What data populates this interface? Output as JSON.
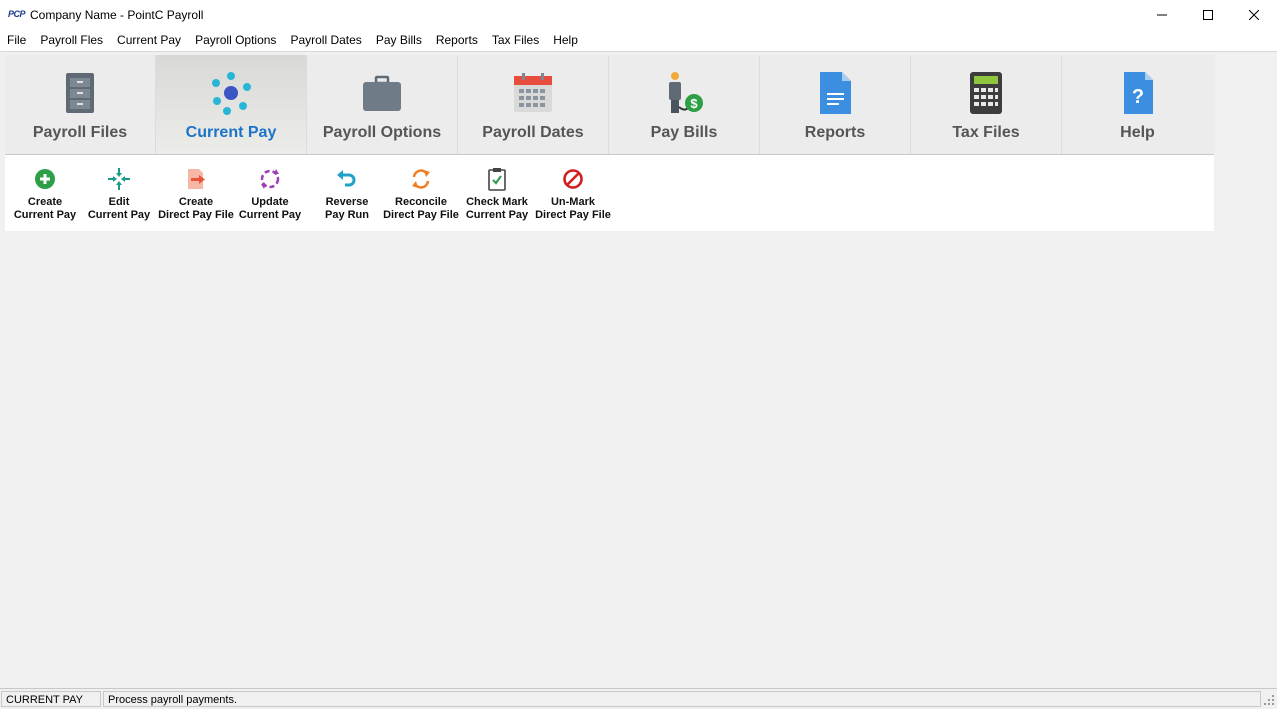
{
  "window": {
    "app_icon_text": "PCP",
    "title": "Company Name - PointC Payroll"
  },
  "menu": [
    "File",
    "Payroll Fles",
    "Current Pay",
    "Payroll Options",
    "Payroll Dates",
    "Pay Bills",
    "Reports",
    "Tax Files",
    "Help"
  ],
  "ribbon": {
    "active_tab": "Current Pay",
    "tabs": [
      {
        "label": "Payroll Files",
        "icon": "filing-cabinet-icon"
      },
      {
        "label": "Current Pay",
        "icon": "network-nodes-icon"
      },
      {
        "label": "Payroll Options",
        "icon": "briefcase-icon"
      },
      {
        "label": "Payroll Dates",
        "icon": "calendar-icon"
      },
      {
        "label": "Pay Bills",
        "icon": "person-dollar-icon"
      },
      {
        "label": "Reports",
        "icon": "document-icon"
      },
      {
        "label": "Tax Files",
        "icon": "calculator-icon"
      },
      {
        "label": "Help",
        "icon": "help-document-icon"
      }
    ]
  },
  "toolbar": {
    "buttons": [
      {
        "line1": "Create",
        "line2": "Current Pay",
        "icon": "plus-circle-icon",
        "color": "#2e9e47"
      },
      {
        "line1": "Edit",
        "line2": "Current Pay",
        "icon": "compress-arrows-icon",
        "color": "#1a9a8a"
      },
      {
        "line1": "Create",
        "line2": "Direct Pay File",
        "icon": "file-export-icon",
        "color": "#e8553a"
      },
      {
        "line1": "Update",
        "line2": "Current Pay",
        "icon": "refresh-dashed-icon",
        "color": "#9b3fb5"
      },
      {
        "line1": "Reverse",
        "line2": "Pay Run",
        "icon": "undo-arrow-icon",
        "color": "#1fa3c9"
      },
      {
        "line1": "Reconcile",
        "line2": "Direct Pay File",
        "icon": "sync-icon",
        "color": "#ef7d22"
      },
      {
        "line1": "Check Mark",
        "line2": "Current Pay",
        "icon": "clipboard-check-icon",
        "color": "#3a9b57"
      },
      {
        "line1": "Un-Mark",
        "line2": "Direct Pay File",
        "icon": "prohibited-icon",
        "color": "#d11f1f"
      }
    ]
  },
  "status": {
    "section": "CURRENT PAY",
    "message": "Process payroll payments."
  },
  "colors": {
    "active_tab_text": "#1b74c8",
    "tab_text": "#555555"
  }
}
